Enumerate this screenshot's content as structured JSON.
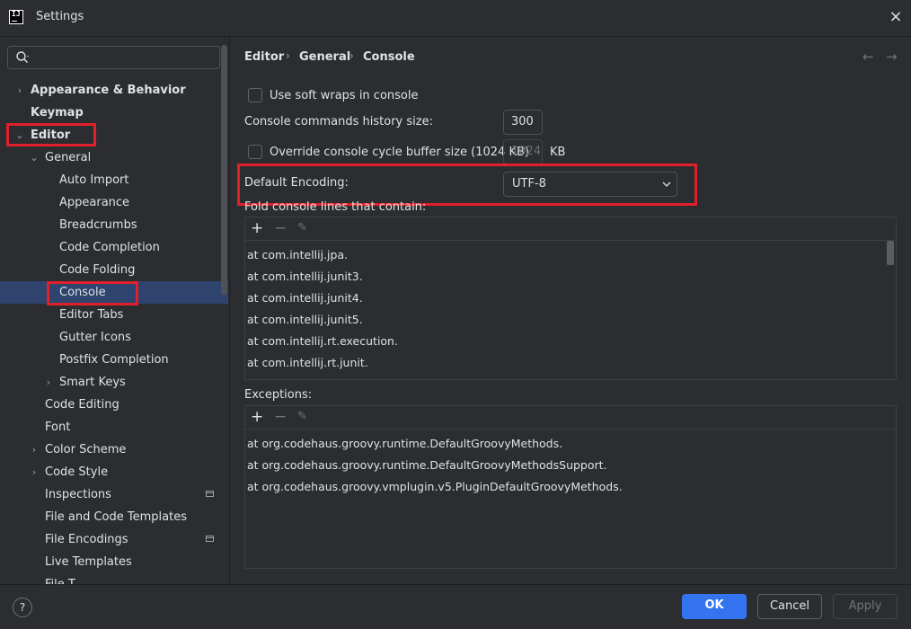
{
  "window": {
    "title": "Settings",
    "close": "×"
  },
  "breadcrumb": [
    "Editor",
    "General",
    "Console"
  ],
  "sidebar": {
    "items": [
      {
        "label": "Appearance & Behavior",
        "level": 0,
        "arrow": "›",
        "bold": true
      },
      {
        "label": "Keymap",
        "level": 0,
        "arrow": "",
        "bold": true
      },
      {
        "label": "Editor",
        "level": 0,
        "arrow": "⌄",
        "bold": true
      },
      {
        "label": "General",
        "level": 1,
        "arrow": "⌄"
      },
      {
        "label": "Auto Import",
        "level": 2,
        "arrow": ""
      },
      {
        "label": "Appearance",
        "level": 2,
        "arrow": ""
      },
      {
        "label": "Breadcrumbs",
        "level": 2,
        "arrow": ""
      },
      {
        "label": "Code Completion",
        "level": 2,
        "arrow": ""
      },
      {
        "label": "Code Folding",
        "level": 2,
        "arrow": ""
      },
      {
        "label": "Console",
        "level": 2,
        "arrow": "",
        "selected": true
      },
      {
        "label": "Editor Tabs",
        "level": 2,
        "arrow": ""
      },
      {
        "label": "Gutter Icons",
        "level": 2,
        "arrow": ""
      },
      {
        "label": "Postfix Completion",
        "level": 2,
        "arrow": ""
      },
      {
        "label": "Smart Keys",
        "level": 2,
        "arrow": "›"
      },
      {
        "label": "Code Editing",
        "level": 1,
        "arrow": ""
      },
      {
        "label": "Font",
        "level": 1,
        "arrow": ""
      },
      {
        "label": "Color Scheme",
        "level": 1,
        "arrow": "›"
      },
      {
        "label": "Code Style",
        "level": 1,
        "arrow": "›"
      },
      {
        "label": "Inspections",
        "level": 1,
        "arrow": "",
        "scope": true
      },
      {
        "label": "File and Code Templates",
        "level": 1,
        "arrow": ""
      },
      {
        "label": "File Encodings",
        "level": 1,
        "arrow": "",
        "scope": true
      },
      {
        "label": "Live Templates",
        "level": 1,
        "arrow": ""
      },
      {
        "label": "File T",
        "level": 1,
        "arrow": ""
      }
    ]
  },
  "console": {
    "soft_wraps_label": "Use soft wraps in console",
    "soft_wraps_checked": false,
    "history_label": "Console commands history size:",
    "history_value": "300",
    "override_label": "Override console cycle buffer size (1024 KB)",
    "override_checked": false,
    "buffer_value": "1024",
    "buffer_unit": "KB",
    "encoding_label": "Default Encoding:",
    "encoding_value": "UTF-8",
    "fold_label": "Fold console lines that contain:",
    "fold_lines": [
      "at com.intellij.jpa.",
      "at com.intellij.junit3.",
      "at com.intellij.junit4.",
      "at com.intellij.junit5.",
      "at com.intellij.rt.execution.",
      "at com.intellij.rt.junit."
    ],
    "exceptions_label": "Exceptions:",
    "exception_lines": [
      "at org.codehaus.groovy.runtime.DefaultGroovyMethods.",
      "at org.codehaus.groovy.runtime.DefaultGroovyMethodsSupport.",
      "at org.codehaus.groovy.vmplugin.v5.PluginDefaultGroovyMethods."
    ]
  },
  "toolbar_glyphs": {
    "add": "+",
    "remove": "−",
    "edit": "✎"
  },
  "nav": {
    "back": "←",
    "forward": "→"
  },
  "footer": {
    "help": "?",
    "ok": "OK",
    "cancel": "Cancel",
    "apply": "Apply"
  },
  "colors": {
    "accent": "#3574f0",
    "highlight": "#e0202a",
    "selection": "#2e436e"
  }
}
